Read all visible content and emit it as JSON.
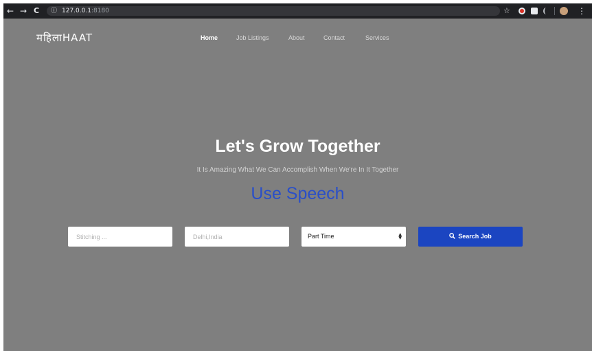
{
  "browser": {
    "back_glyph": "←",
    "forward_glyph": "→",
    "reload_glyph": "C",
    "info_glyph": "ⓘ",
    "url_host": "127.0.0.1",
    "url_port": ":8180",
    "bookmark_glyph": "☆",
    "menu_glyph": "⋮"
  },
  "header": {
    "brand": "महिलाHAAT",
    "nav": [
      {
        "label": "Home",
        "active": true
      },
      {
        "label": "Job Listings"
      },
      {
        "label": "About"
      },
      {
        "label": "Contact"
      },
      {
        "label": "Services"
      }
    ]
  },
  "hero": {
    "title": "Let's Grow Together",
    "subtitle": "It Is Amazing What We Can Accomplish When We're In It Together",
    "speech_label": "Use Speech"
  },
  "search": {
    "keyword_placeholder": "Stitching ...",
    "location_placeholder": "Delhi,India",
    "job_type_selected": "Part Time",
    "button_label": "Search Job"
  },
  "colors": {
    "hero_background": "#7f7f7f",
    "accent_blue": "#1b45c1",
    "speech_blue": "#2a4fc8"
  }
}
